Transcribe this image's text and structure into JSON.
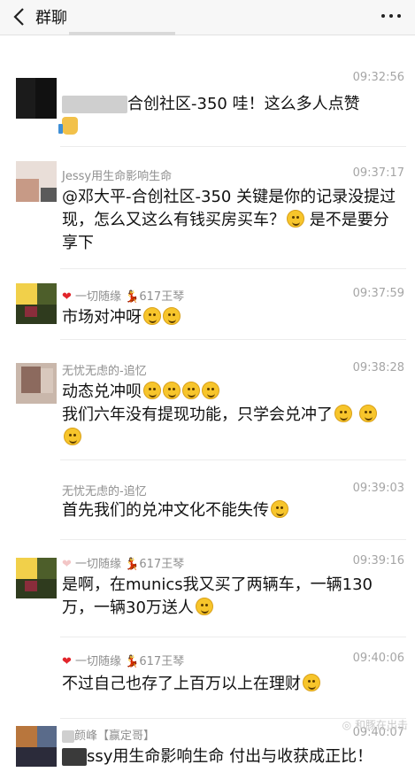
{
  "header": {
    "title": "群聊",
    "back_icon": "chevron-left-icon",
    "more_icon": "more-dots-icon"
  },
  "messages": [
    {
      "sender": "",
      "time": "09:32:56",
      "text": "合创社区-350 哇！这么多人点赞",
      "trailing_icon": "thumbs-up-icon"
    },
    {
      "sender": "Jessy用生命影响生命",
      "time": "09:37:17",
      "text": "@邓大平-合创社区-350 关键是你的记录没提过现，怎么又这么有钱买房买车？",
      "text_after_emoji": " 是不是要分享下"
    },
    {
      "sender": "一切随缘",
      "sender_suffix": "617王琴",
      "time": "09:37:59",
      "text": "市场对冲呀"
    },
    {
      "sender": "无忧无虑的-追忆",
      "time": "09:38:28",
      "line1": "动态兑冲呗",
      "line2": "我们六年没有提现功能，只学会兑冲了"
    },
    {
      "sender": "无忧无虑的-追忆",
      "time": "09:39:03",
      "text": "首先我们的兑冲文化不能失传"
    },
    {
      "sender": "一切随缘",
      "sender_suffix": "617王琴",
      "time": "09:39:16",
      "text": "是啊，在munics我又买了两辆车，一辆130万，一辆30万送人"
    },
    {
      "sender": "一切随缘",
      "sender_suffix": "617王琴",
      "time": "09:40:06",
      "text": "不过自己也存了上百万以上在理财"
    },
    {
      "sender": "颜峰【赢定哥】",
      "time": "09:40:07",
      "text": "ssy用生命影响生命 付出与收获成正比！"
    }
  ],
  "watermark": "和豚在出击"
}
